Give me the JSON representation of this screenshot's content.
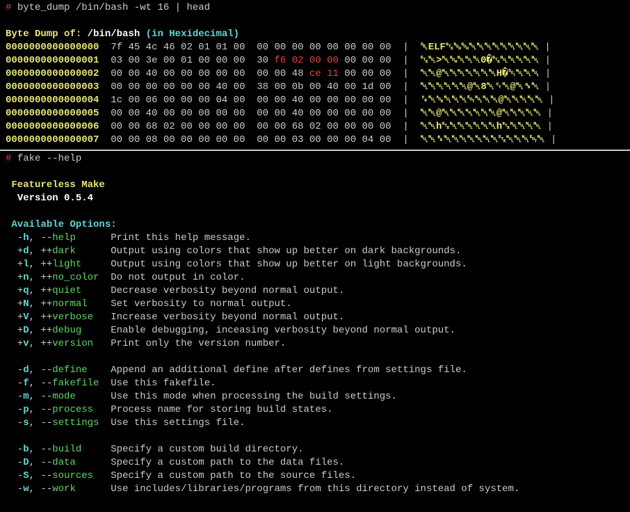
{
  "top": {
    "prompt": "#",
    "command": "byte_dump /bin/bash -wt 16 | head",
    "header_label": "Byte Dump of:",
    "header_path": "/bin/bash",
    "header_fmt": "(in Hexidecimal)",
    "rows": [
      {
        "addr": "0000000000000000",
        "h1": "7f 45 4c 46 02 01 01 00",
        "h2": "00 00 00 00 00 00 00 00",
        "red": false,
        "ascii": "␡ELF␂␁␁␀␀␀␀␀␀␀␀␀"
      },
      {
        "addr": "0000000000000001",
        "h1": "03 00 3e 00 01 00 00 00",
        "h2a": "30 ",
        "h2r": "f6 02 00 00",
        "h2b": " 00 00 00",
        "red": true,
        "ascii": "␃␀>␀␁␀␀␀0�␂␀␀␀␀␀"
      },
      {
        "addr": "0000000000000002",
        "h1": "00 00 40 00 00 00 00 00",
        "h2a": "00 00 48 ",
        "h2r": "ce 11",
        "h2b": " 00 00 00",
        "red": true,
        "ascii": "␀␀@␀␀␀␀␀␀␀H�␑␀␀␀"
      },
      {
        "addr": "0000000000000003",
        "h1": "00 00 00 00 00 00 40 00",
        "h2": "38 00 0b 00 40 00 1d 00",
        "red": false,
        "ascii": "␀␀␀␀␀␀@␀8␀␋␀@␀␝␀"
      },
      {
        "addr": "0000000000000004",
        "h1": "1c 00 06 00 00 00 04 00",
        "h2": "00 00 40 00 00 00 00 00",
        "red": false,
        "ascii": "␜␀␆␀␀␀␄␀␀␀@␀␀␀␀␀"
      },
      {
        "addr": "0000000000000005",
        "h1": "00 00 40 00 00 00 00 00",
        "h2": "00 00 40 00 00 00 00 00",
        "red": false,
        "ascii": "␀␀@␀␀␀␀␀␀␀@␀␀␀␀␀"
      },
      {
        "addr": "0000000000000006",
        "h1": "00 00 68 02 00 00 00 00",
        "h2": "00 00 68 02 00 00 00 00",
        "red": false,
        "ascii": "␀␀h␂␀␀␀␀␀␀h␂␀␀␀␀"
      },
      {
        "addr": "0000000000000007",
        "h1": "00 00 08 00 00 00 00 00",
        "h2": "00 00 03 00 00 00 04 00",
        "red": false,
        "ascii": "␀␀␈␀␀␀␀␀␀␀␃␀␀␀␄␀"
      }
    ]
  },
  "bottom": {
    "prompt": "#",
    "command": "fake --help",
    "title": "Featureless Make",
    "version_label": "Version 0.5.4",
    "options_header": "Available Options:",
    "groups": [
      [
        {
          "pshort": "-",
          "short": "h",
          "plong": "--",
          "long": "help",
          "desc": "Print this help message."
        },
        {
          "pshort": "+",
          "short": "d",
          "plong": "++",
          "long": "dark",
          "desc": "Output using colors that show up better on dark backgrounds."
        },
        {
          "pshort": "+",
          "short": "l",
          "plong": "++",
          "long": "light",
          "desc": "Output using colors that show up better on light backgrounds."
        },
        {
          "pshort": "+",
          "short": "n",
          "plong": "++",
          "long": "no_color",
          "desc": "Do not output in color."
        },
        {
          "pshort": "+",
          "short": "q",
          "plong": "++",
          "long": "quiet",
          "desc": "Decrease verbosity beyond normal output."
        },
        {
          "pshort": "+",
          "short": "N",
          "plong": "++",
          "long": "normal",
          "desc": "Set verbosity to normal output."
        },
        {
          "pshort": "+",
          "short": "V",
          "plong": "++",
          "long": "verbose",
          "desc": "Increase verbosity beyond normal output."
        },
        {
          "pshort": "+",
          "short": "D",
          "plong": "++",
          "long": "debug",
          "desc": "Enable debugging, inceasing verbosity beyond normal output."
        },
        {
          "pshort": "+",
          "short": "v",
          "plong": "++",
          "long": "version",
          "desc": "Print only the version number."
        }
      ],
      [
        {
          "pshort": "-",
          "short": "d",
          "plong": "--",
          "long": "define",
          "desc": "Append an additional define after defines from settings file."
        },
        {
          "pshort": "-",
          "short": "f",
          "plong": "--",
          "long": "fakefile",
          "desc": "Use this fakefile."
        },
        {
          "pshort": "-",
          "short": "m",
          "plong": "--",
          "long": "mode",
          "desc": "Use this mode when processing the build settings."
        },
        {
          "pshort": "-",
          "short": "p",
          "plong": "--",
          "long": "process",
          "desc": "Process name for storing build states."
        },
        {
          "pshort": "-",
          "short": "s",
          "plong": "--",
          "long": "settings",
          "desc": "Use this settings file."
        }
      ],
      [
        {
          "pshort": "-",
          "short": "b",
          "plong": "--",
          "long": "build",
          "desc": "Specify a custom build directory."
        },
        {
          "pshort": "-",
          "short": "D",
          "plong": "--",
          "long": "data",
          "desc": "Specify a custom path to the data files."
        },
        {
          "pshort": "-",
          "short": "S",
          "plong": "--",
          "long": "sources",
          "desc": "Specify a custom path to the source files."
        },
        {
          "pshort": "-",
          "short": "w",
          "plong": "--",
          "long": "work",
          "desc": "Use includes/libraries/programs from this directory instead of system."
        }
      ]
    ]
  }
}
